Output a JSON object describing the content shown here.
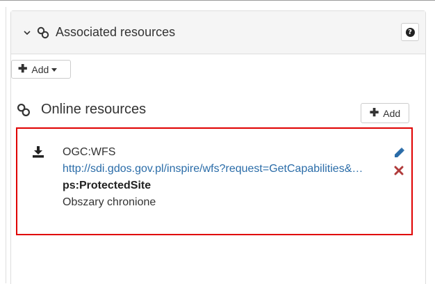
{
  "panel": {
    "title": "Associated resources",
    "help_label": "?"
  },
  "add_dropdown": {
    "label": "Add"
  },
  "online_resources": {
    "title": "Online resources",
    "add_label": "Add",
    "items": [
      {
        "protocol": "OGC:WFS",
        "url": "http://sdi.gdos.gov.pl/inspire/wfs?request=GetCapabilities&service=WFS",
        "name": "ps:ProtectedSite",
        "description": "Obszary chronione"
      }
    ]
  },
  "colors": {
    "link": "#2a6ca8",
    "edit": "#2a6ca8",
    "delete": "#b03a3a",
    "highlight": "#e00000"
  }
}
